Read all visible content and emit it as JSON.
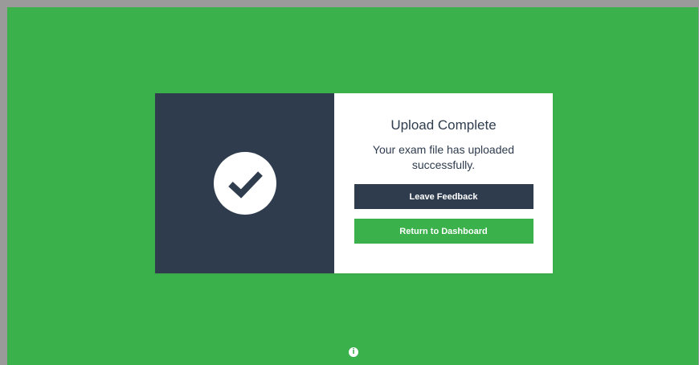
{
  "dialog": {
    "title": "Upload Complete",
    "message": "Your exam file has uploaded successfully.",
    "feedback_button_label": "Leave Feedback",
    "dashboard_button_label": "Return to Dashboard",
    "icon": "checkmark-icon"
  },
  "footer": {
    "info_icon": "info-icon"
  },
  "colors": {
    "background": "#3bb14c",
    "panel_dark": "#2e3c4e",
    "panel_light": "#ffffff",
    "primary_button": "#2e3c4e",
    "secondary_button": "#3bb14c"
  }
}
